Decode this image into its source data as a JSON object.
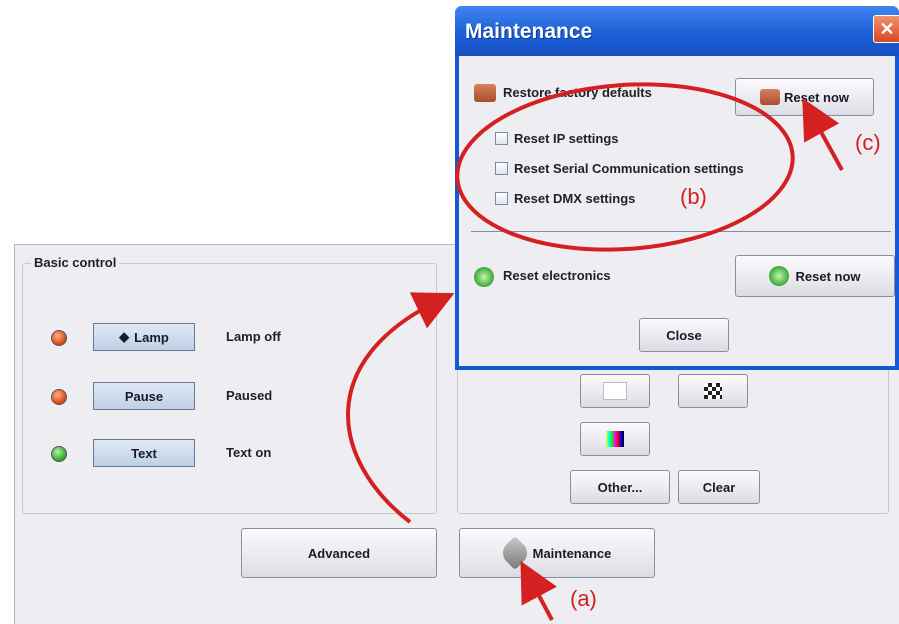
{
  "basic_control": {
    "title": "Basic control",
    "rows": [
      {
        "button": "Lamp",
        "status": "Lamp off",
        "led": "red",
        "icon": "lamp-icon"
      },
      {
        "button": "Pause",
        "status": "Paused",
        "led": "red"
      },
      {
        "button": "Text",
        "status": "Text on",
        "led": "green"
      }
    ]
  },
  "pattern_panel": {
    "other_label": "Other...",
    "clear_label": "Clear"
  },
  "bottom_buttons": {
    "advanced_label": "Advanced",
    "maintenance_label": "Maintenance"
  },
  "dialog": {
    "title": "Maintenance",
    "restore_label": "Restore factory defaults",
    "reset_now_label": "Reset now",
    "checkboxes": [
      {
        "label": "Reset IP settings",
        "checked": false
      },
      {
        "label": "Reset Serial Communication settings",
        "checked": false
      },
      {
        "label": "Reset DMX settings",
        "checked": false
      }
    ],
    "reset_electronics_label": "Reset electronics",
    "reset_now_label_2": "Reset now",
    "close_label": "Close"
  },
  "annotations": {
    "a": "(a)",
    "b": "(b)",
    "c": "(c)"
  },
  "colors": {
    "titlebar": "#1d5fd6",
    "annotation": "#d42020",
    "led_red": "#e0501c",
    "led_green": "#3ab040"
  }
}
